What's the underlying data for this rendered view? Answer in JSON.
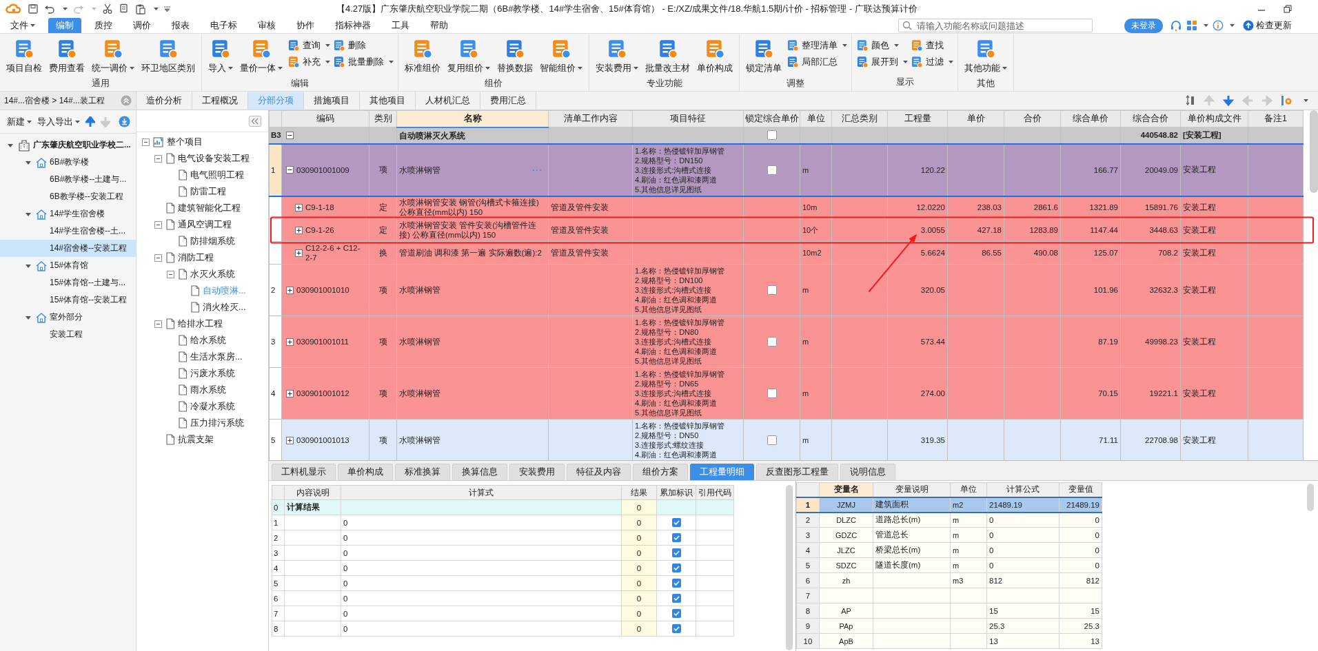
{
  "title_bar": {
    "title": "【4.27版】广东肇庆航空职业学院二期（6B#教学楼、14#学生宿舍、15#体育馆） - E:/XZ/成果文件/18.华航1.5期/计价 - 招标管理 - 广联达预算计价"
  },
  "menu": [
    {
      "label": "文件",
      "dropdown": true,
      "selected": false
    },
    {
      "label": "编制",
      "dropdown": false,
      "selected": true
    },
    {
      "label": "质控",
      "dropdown": false,
      "selected": false
    },
    {
      "label": "调价",
      "dropdown": false,
      "selected": false
    },
    {
      "label": "报表",
      "dropdown": false,
      "selected": false
    },
    {
      "label": "电子标",
      "dropdown": false,
      "selected": false
    },
    {
      "label": "审核",
      "dropdown": false,
      "selected": false
    },
    {
      "label": "协作",
      "dropdown": false,
      "selected": false
    },
    {
      "label": "指标神器",
      "dropdown": false,
      "selected": false
    },
    {
      "label": "工具",
      "dropdown": false,
      "selected": false
    },
    {
      "label": "帮助",
      "dropdown": false,
      "selected": false
    }
  ],
  "search": {
    "placeholder": "请输入功能名称或问题描述"
  },
  "account": {
    "login": "未登录",
    "update": "检查更新"
  },
  "ribbon": [
    {
      "label": "通用",
      "buttons": [
        {
          "kind": "large",
          "label": "项目自检",
          "dropdown": false
        },
        {
          "kind": "large",
          "label": "费用查看",
          "dropdown": false
        },
        {
          "kind": "large",
          "label": "统一调价",
          "dropdown": true
        },
        {
          "kind": "large",
          "label": "环卫地区类别",
          "dropdown": false
        }
      ]
    },
    {
      "label": "编辑",
      "buttons": [
        {
          "kind": "large",
          "label": "导入",
          "dropdown": true
        },
        {
          "kind": "large",
          "label": "量价一体",
          "dropdown": true
        },
        {
          "kind": "small",
          "label": "查询",
          "dropdown": true
        },
        {
          "kind": "small",
          "label": "补充",
          "dropdown": true
        },
        {
          "kind": "small",
          "label": "删除",
          "dropdown": false
        },
        {
          "kind": "small",
          "label": "批量删除",
          "dropdown": true
        }
      ]
    },
    {
      "label": "组价",
      "buttons": [
        {
          "kind": "large",
          "label": "标准组价",
          "dropdown": false
        },
        {
          "kind": "large",
          "label": "复用组价",
          "dropdown": true
        },
        {
          "kind": "large",
          "label": "替换数据",
          "dropdown": false
        },
        {
          "kind": "large",
          "label": "智能组价",
          "dropdown": true
        }
      ]
    },
    {
      "label": "专业功能",
      "buttons": [
        {
          "kind": "large",
          "label": "安装费用",
          "dropdown": true
        },
        {
          "kind": "large",
          "label": "批量改主材",
          "dropdown": false
        },
        {
          "kind": "large",
          "label": "单价构成",
          "dropdown": false
        }
      ]
    },
    {
      "label": "调整",
      "buttons": [
        {
          "kind": "large",
          "label": "锁定清单",
          "dropdown": false
        },
        {
          "kind": "small",
          "label": "整理清单",
          "dropdown": true
        },
        {
          "kind": "small",
          "label": "局部汇总",
          "dropdown": false
        }
      ]
    },
    {
      "label": "显示",
      "buttons": [
        {
          "kind": "small",
          "label": "颜色",
          "dropdown": true
        },
        {
          "kind": "small",
          "label": "展开到",
          "dropdown": true
        },
        {
          "kind": "small",
          "label": "查找",
          "dropdown": false
        },
        {
          "kind": "small",
          "label": "过滤",
          "dropdown": true
        }
      ]
    },
    {
      "label": "其他",
      "buttons": [
        {
          "kind": "large",
          "label": "其他功能",
          "dropdown": true
        }
      ]
    }
  ],
  "breadcrumb": "14#...宿舍楼 > 14#...装工程",
  "view_tabs": [
    {
      "label": "造价分析",
      "selected": false
    },
    {
      "label": "工程概况",
      "selected": false
    },
    {
      "label": "分部分项",
      "selected": true
    },
    {
      "label": "措施项目",
      "selected": false
    },
    {
      "label": "其他项目",
      "selected": false
    },
    {
      "label": "人材机汇总",
      "selected": false
    },
    {
      "label": "费用汇总",
      "selected": false
    }
  ],
  "project_toolbar": [
    {
      "label": "新建",
      "dropdown": true
    },
    {
      "label": "导入导出",
      "dropdown": true
    }
  ],
  "project_tree": [
    {
      "label": "广东肇庆航空职业学校二...",
      "kind": "project",
      "expanded": true,
      "selected": false,
      "children": [
        {
          "label": "6B#教学楼",
          "kind": "building",
          "expanded": true,
          "selected": false,
          "children": [
            {
              "label": "6B#教学楼--土建与...",
              "selected": false
            },
            {
              "label": "6B教学楼--安装工程",
              "selected": false
            }
          ]
        },
        {
          "label": "14#学生宿舍楼",
          "kind": "building",
          "expanded": true,
          "selected": false,
          "children": [
            {
              "label": "14#学生宿舍楼--土...",
              "selected": false
            },
            {
              "label": "14#宿舍楼--安装工程",
              "selected": true
            }
          ]
        },
        {
          "label": "15#体育馆",
          "kind": "building",
          "expanded": true,
          "selected": false,
          "children": [
            {
              "label": "15#体育馆--土建与...",
              "selected": false
            },
            {
              "label": "15#体育馆--安装工程",
              "selected": false
            }
          ]
        },
        {
          "label": "室外部分",
          "kind": "building",
          "expanded": true,
          "selected": false,
          "children": [
            {
              "label": "安装工程",
              "selected": false
            }
          ]
        }
      ]
    }
  ],
  "section_tree": [
    {
      "label": "整个项目",
      "kind": "root",
      "expanded": true,
      "selected": false,
      "children": [
        {
          "label": "电气设备安装工程",
          "kind": "section",
          "expanded": true,
          "selected": false,
          "children": [
            {
              "label": "电气照明工程",
              "kind": "section",
              "selected": false
            },
            {
              "label": "防雷工程",
              "kind": "section",
              "selected": false
            }
          ]
        },
        {
          "label": "建筑智能化工程",
          "kind": "section",
          "selected": false
        },
        {
          "label": "通风空调工程",
          "kind": "section",
          "expanded": true,
          "selected": false,
          "children": [
            {
              "label": "防排烟系统",
              "kind": "section",
              "selected": false
            }
          ]
        },
        {
          "label": "消防工程",
          "kind": "section",
          "expanded": true,
          "selected": false,
          "children": [
            {
              "label": "水灭火系统",
              "kind": "section",
              "expanded": true,
              "selected": false,
              "children": [
                {
                  "label": "自动喷淋...",
                  "kind": "section",
                  "selected": true
                },
                {
                  "label": "消火栓灭...",
                  "kind": "section",
                  "selected": false
                }
              ]
            }
          ]
        },
        {
          "label": "给排水工程",
          "kind": "section",
          "expanded": true,
          "selected": false,
          "children": [
            {
              "label": "给水系统",
              "kind": "section",
              "selected": false
            },
            {
              "label": "生活水泵房...",
              "kind": "section",
              "selected": false
            },
            {
              "label": "污废水系统",
              "kind": "section",
              "selected": false
            },
            {
              "label": "雨水系统",
              "kind": "section",
              "selected": false
            },
            {
              "label": "冷凝水系统",
              "kind": "section",
              "selected": false
            },
            {
              "label": "压力排污系统",
              "kind": "section",
              "selected": false
            }
          ]
        },
        {
          "label": "抗震支架",
          "kind": "section",
          "selected": false
        }
      ]
    }
  ],
  "bill_table": {
    "columns": [
      {
        "label": "编码",
        "selected": false
      },
      {
        "label": "类别",
        "selected": false
      },
      {
        "label": "名称",
        "selected": true
      },
      {
        "label": "清单工作内容",
        "selected": false
      },
      {
        "label": "项目特征",
        "selected": false
      },
      {
        "label": "锁定综合单价",
        "selected": false
      },
      {
        "label": "单位",
        "selected": false
      },
      {
        "label": "汇总类别",
        "selected": false
      },
      {
        "label": "工程量",
        "selected": false
      },
      {
        "label": "单价",
        "selected": false
      },
      {
        "label": "合价",
        "selected": false
      },
      {
        "label": "综合单价",
        "selected": false
      },
      {
        "label": "综合合价",
        "selected": false
      },
      {
        "label": "单价构成文件",
        "selected": false
      },
      {
        "label": "备注1",
        "selected": false
      }
    ],
    "rows": [
      {
        "kind": "section",
        "num": "B3",
        "expanded": true,
        "name": "自动喷淋灭火系统",
        "locked": false,
        "amount": "440548.82",
        "file": "[安装工程]",
        "color": "#c8c8c8",
        "selected": false,
        "circled": false
      },
      {
        "kind": "item",
        "num": "1",
        "code": "030901001009",
        "expanded": true,
        "type": "项",
        "name": "水喷淋钢管",
        "more": "···",
        "features": [
          "1.名称：热侵镀锌加厚钢管",
          "2.规格型号：DN150",
          "3.连接形式:沟槽式连接",
          "4.刷油：红色调和漆两道",
          "5.其他信息详见图纸"
        ],
        "locked": false,
        "unit": "m",
        "qty": "120.22",
        "unit_price": "166.77",
        "amount": "20049.09",
        "file": "安装工程",
        "color": "#b398bf",
        "selected": true,
        "circled": false
      },
      {
        "kind": "quota",
        "code": "C9-1-18",
        "expanded": false,
        "type": "定",
        "name": "水喷淋钢管安装 钢管(沟槽式卡箍连接) 公称直径(mm以内) 150",
        "content": "管道及管件安装",
        "unit": "10m",
        "qty": "12.0220",
        "price": "238.03",
        "total": "2861.6",
        "unit_price": "1321.89",
        "amount": "15891.76",
        "file": "安装工程",
        "color": "#fa9393",
        "selected": false,
        "circled": false
      },
      {
        "kind": "quota",
        "code": "C9-1-26",
        "expanded": false,
        "type": "定",
        "name": "水喷淋钢管安装 管件安装(沟槽管件连接) 公称直径(mm以内) 150",
        "content": "管道及管件安装",
        "unit": "10个",
        "qty": "3.0055",
        "price": "427.18",
        "total": "1283.89",
        "unit_price": "1147.44",
        "amount": "3448.63",
        "file": "安装工程",
        "color": "#fa9393",
        "selected": false,
        "circled": true
      },
      {
        "kind": "quota",
        "code": "C12-2-6 + C12-2-7",
        "expanded": false,
        "type": "换",
        "name": "管道刷油 调和漆 第一遍 实际遍数(遍):2",
        "content": "管道及管件安装",
        "unit": "10m2",
        "qty": "5.6624",
        "price": "86.55",
        "total": "490.08",
        "unit_price": "125.07",
        "amount": "708.2",
        "file": "安装工程",
        "color": "#fa9393",
        "selected": false,
        "circled": false
      },
      {
        "kind": "item",
        "num": "2",
        "code": "030901001010",
        "expanded": false,
        "type": "项",
        "name": "水喷淋钢管",
        "features": [
          "1.名称：热侵镀锌加厚钢管",
          "2.规格型号：DN100",
          "3.连接形式:沟槽式连接",
          "4.刷油：红色调和漆两道",
          "5.其他信息详见图纸"
        ],
        "locked": false,
        "unit": "m",
        "qty": "320.05",
        "unit_price": "101.96",
        "amount": "32632.3",
        "file": "安装工程",
        "color": "#fa9393",
        "selected": false,
        "circled": false
      },
      {
        "kind": "item",
        "num": "3",
        "code": "030901001011",
        "expanded": false,
        "type": "项",
        "name": "水喷淋钢管",
        "features": [
          "1.名称：热侵镀锌加厚钢管",
          "2.规格型号：DN80",
          "3.连接形式:沟槽式连接",
          "4.刷油：红色调和漆两道",
          "5.其他信息详见图纸"
        ],
        "locked": false,
        "unit": "m",
        "qty": "573.44",
        "unit_price": "87.19",
        "amount": "49998.23",
        "file": "安装工程",
        "color": "#fa9393",
        "selected": false,
        "circled": false
      },
      {
        "kind": "item",
        "num": "4",
        "code": "030901001012",
        "expanded": false,
        "type": "项",
        "name": "水喷淋钢管",
        "features": [
          "1.名称：热侵镀锌加厚钢管",
          "2.规格型号：DN65",
          "3.连接形式:沟槽式连接",
          "4.刷油：红色调和漆两道",
          "5.其他信息详见图纸"
        ],
        "locked": false,
        "unit": "m",
        "qty": "274.00",
        "unit_price": "70.15",
        "amount": "19221.1",
        "file": "安装工程",
        "color": "#fa9393",
        "selected": false,
        "circled": false
      },
      {
        "kind": "item",
        "num": "5",
        "code": "030901001013",
        "expanded": false,
        "type": "项",
        "name": "水喷淋钢管",
        "features": [
          "1.名称：热侵镀锌加厚钢管",
          "2.规格型号：DN50",
          "3.连接形式:螺纹连接",
          "4.刷油：红色调和漆两道"
        ],
        "locked": false,
        "unit": "m",
        "qty": "319.35",
        "unit_price": "71.11",
        "amount": "22708.98",
        "file": "安装工程",
        "color": "#dde9fb",
        "selected": false,
        "circled": false
      }
    ]
  },
  "detail_tabs": [
    {
      "label": "工料机显示",
      "selected": false
    },
    {
      "label": "单价构成",
      "selected": false
    },
    {
      "label": "标准换算",
      "selected": false
    },
    {
      "label": "换算信息",
      "selected": false
    },
    {
      "label": "安装费用",
      "selected": false
    },
    {
      "label": "特征及内容",
      "selected": false
    },
    {
      "label": "组价方案",
      "selected": false
    },
    {
      "label": "工程量明细",
      "selected": true
    },
    {
      "label": "反查图形工程量",
      "selected": false
    },
    {
      "label": "说明信息",
      "selected": false
    }
  ],
  "formula_table": {
    "columns": [
      "内容说明",
      "计算式",
      "结果",
      "累加标识",
      "引用代码"
    ],
    "rows": [
      {
        "kind": "total",
        "num": "0",
        "desc": "计算结果",
        "result": "0"
      },
      {
        "kind": "line",
        "num": "1",
        "formula": "0",
        "result": "0",
        "checked": true
      },
      {
        "kind": "line",
        "num": "2",
        "formula": "0",
        "result": "0",
        "checked": true
      },
      {
        "kind": "line",
        "num": "3",
        "formula": "0",
        "result": "0",
        "checked": true
      },
      {
        "kind": "line",
        "num": "4",
        "formula": "0",
        "result": "0",
        "checked": true
      },
      {
        "kind": "line",
        "num": "5",
        "formula": "0",
        "result": "0",
        "checked": true
      },
      {
        "kind": "line",
        "num": "6",
        "formula": "0",
        "result": "0",
        "checked": true
      },
      {
        "kind": "line",
        "num": "7",
        "formula": "0",
        "result": "0",
        "checked": true
      },
      {
        "kind": "line",
        "num": "8",
        "formula": "0",
        "result": "0",
        "checked": true
      }
    ]
  },
  "variable_table": {
    "columns": [
      "变量名",
      "变量说明",
      "单位",
      "计算公式",
      "变量值"
    ],
    "rows": [
      {
        "num": "1",
        "name": "JZMJ",
        "desc": "建筑面积",
        "unit": "m2",
        "formula": "21489.19",
        "value": "21489.19",
        "selected": true
      },
      {
        "num": "2",
        "name": "DLZC",
        "desc": "道路总长(m)",
        "unit": "m",
        "formula": "0",
        "value": "0",
        "selected": false
      },
      {
        "num": "3",
        "name": "GDZC",
        "desc": "管道总长",
        "unit": "m",
        "formula": "0",
        "value": "0",
        "selected": false
      },
      {
        "num": "4",
        "name": "JLZC",
        "desc": "桥梁总长(m)",
        "unit": "m",
        "formula": "0",
        "value": "0",
        "selected": false
      },
      {
        "num": "5",
        "name": "SDZC",
        "desc": "隧道长度(m)",
        "unit": "m",
        "formula": "0",
        "value": "0",
        "selected": false
      },
      {
        "num": "6",
        "name": "zh",
        "unit": "m3",
        "formula": "812",
        "value": "812",
        "selected": false
      },
      {
        "num": "7",
        "selected": false
      },
      {
        "num": "8",
        "name": "AP",
        "formula": "15",
        "value": "15",
        "selected": false
      },
      {
        "num": "9",
        "name": "PAp",
        "formula": "25.3",
        "value": "25.3",
        "selected": false
      },
      {
        "num": "10",
        "name": "ApB",
        "formula": "13",
        "value": "13",
        "selected": false
      }
    ]
  }
}
